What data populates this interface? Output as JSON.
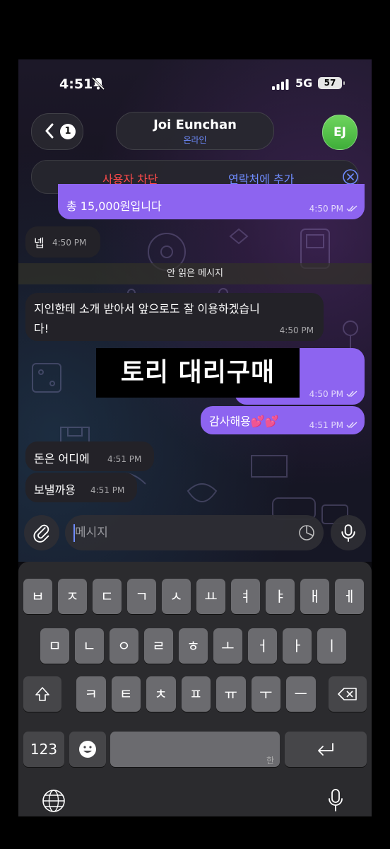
{
  "status_bar": {
    "time": "4:51",
    "network": "5G",
    "battery": "57"
  },
  "header": {
    "back_badge": "1",
    "contact_name": "Joi Eunchan",
    "contact_status": "온라인",
    "avatar_initials": "EJ",
    "block_label": "사용자 차단",
    "add_contact_label": "연락처에 추가"
  },
  "messages": [
    {
      "dir": "out",
      "text": "총 15,000원입니다",
      "time": "4:50 PM"
    },
    {
      "dir": "in",
      "text": "넵",
      "time": "4:50 PM"
    },
    {
      "dir": "in",
      "lines": [
        "지인한테 소개 받아서 앞으로도 잘 이용하겠습니",
        "다!"
      ],
      "time": "4:50 PM"
    },
    {
      "dir": "out",
      "text": "",
      "time": "4:50 PM"
    },
    {
      "dir": "out",
      "text": "감사해용💕💕",
      "time": "4:51 PM"
    },
    {
      "dir": "in",
      "text": "돈은 어디에",
      "time": "4:51 PM"
    },
    {
      "dir": "in",
      "text": "보낼까용",
      "time": "4:51 PM"
    }
  ],
  "unread_divider": "안 읽은 메시지",
  "overlay_text": "토리 대리구매",
  "composer": {
    "placeholder": "메시지"
  },
  "keyboard": {
    "row1": [
      "ㅂ",
      "ㅈ",
      "ㄷ",
      "ㄱ",
      "ㅅ",
      "ㅛ",
      "ㅕ",
      "ㅑ",
      "ㅐ",
      "ㅔ"
    ],
    "row2": [
      "ㅁ",
      "ㄴ",
      "ㅇ",
      "ㄹ",
      "ㅎ",
      "ㅗ",
      "ㅓ",
      "ㅏ",
      "ㅣ"
    ],
    "row3": [
      "ㅋ",
      "ㅌ",
      "ㅊ",
      "ㅍ",
      "ㅠ",
      "ㅜ",
      "ㅡ"
    ],
    "numbers_label": "123",
    "space_hint": "한"
  },
  "colors": {
    "outgoing": "#8d64f0",
    "incoming": "#232228",
    "accent": "#6f8cff",
    "danger": "#ff4a4a",
    "avatar": "#4cbf43"
  },
  "icons": [
    "bell-slash-icon",
    "signal-icon",
    "chevron-left-icon",
    "close-circle-icon",
    "double-check-icon",
    "paperclip-icon",
    "sticker-icon",
    "microphone-icon",
    "shift-icon",
    "backspace-icon",
    "emoji-icon",
    "return-icon",
    "globe-icon"
  ]
}
